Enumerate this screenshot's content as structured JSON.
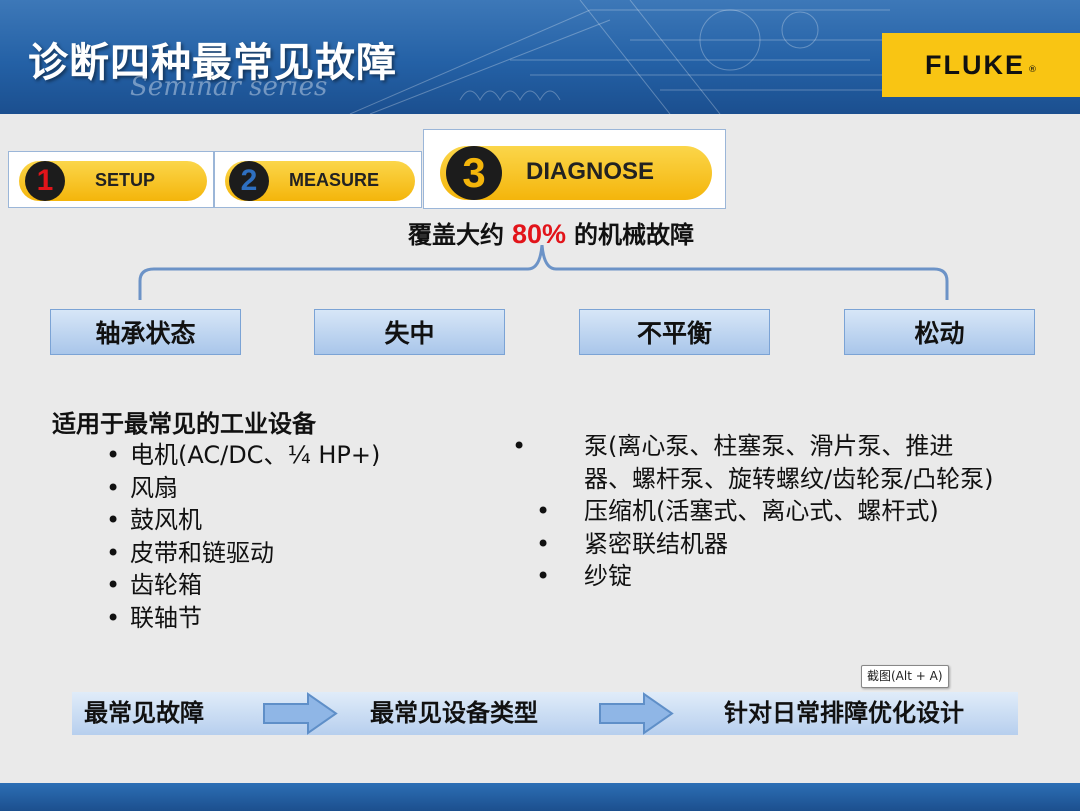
{
  "header": {
    "title": "诊断四种最常见故障",
    "subtitle": "Seminar series",
    "logo": "FLUKE",
    "logo_mark": "®"
  },
  "steps": [
    {
      "number": "1",
      "label": "SETUP"
    },
    {
      "number": "2",
      "label": "MEASURE"
    },
    {
      "number": "3",
      "label": "DIAGNOSE"
    }
  ],
  "coverage": {
    "prefix": "覆盖大约",
    "percent": "80%",
    "suffix": "的机械故障"
  },
  "categories": [
    "轴承状态",
    "失中",
    "不平衡",
    "松动"
  ],
  "left_list": {
    "heading": "适用于最常见的工业设备",
    "items": [
      "电机(AC/DC、¼ HP+)",
      "风扇",
      "鼓风机",
      "皮带和链驱动",
      "齿轮箱",
      "联轴节"
    ]
  },
  "right_list": {
    "items": [
      "泵(离心泵、柱塞泵、滑片泵、推进器、螺杆泵、旋转螺纹/齿轮泵/凸轮泵)",
      "压缩机(活塞式、离心式、螺杆式)",
      "紧密联结机器",
      "纱锭"
    ]
  },
  "tooltip": "截图(Alt + A)",
  "flow": [
    "最常见故障",
    "最常见设备类型",
    "针对日常排障优化设计"
  ],
  "colors": {
    "header_blue": "#2461a6",
    "fluke_yellow": "#f9c513",
    "accent_red": "#e2141a"
  }
}
